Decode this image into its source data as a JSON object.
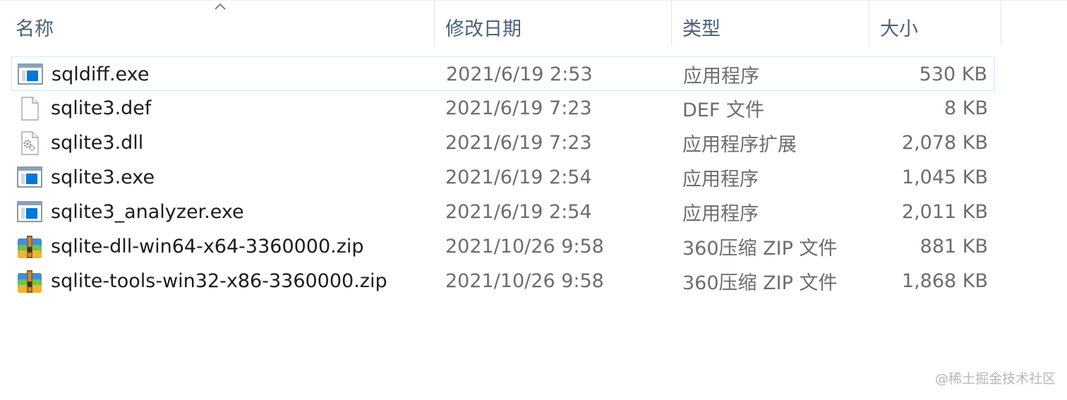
{
  "columns": {
    "name": "名称",
    "date_modified": "修改日期",
    "type": "类型",
    "size": "大小"
  },
  "sort": {
    "column": "name",
    "direction": "ascending",
    "icon": "chevron-up-icon"
  },
  "files": [
    {
      "name": "sqldiff.exe",
      "date": "2021/6/19 2:53",
      "type": "应用程序",
      "size": "530 KB",
      "icon": "exe-app-icon",
      "selected": true
    },
    {
      "name": "sqlite3.def",
      "date": "2021/6/19 7:23",
      "type": "DEF 文件",
      "size": "8 KB",
      "icon": "blank-document-icon",
      "selected": false
    },
    {
      "name": "sqlite3.dll",
      "date": "2021/6/19 7:23",
      "type": "应用程序扩展",
      "size": "2,078 KB",
      "icon": "dll-gear-document-icon",
      "selected": false
    },
    {
      "name": "sqlite3.exe",
      "date": "2021/6/19 2:54",
      "type": "应用程序",
      "size": "1,045 KB",
      "icon": "exe-app-icon",
      "selected": false
    },
    {
      "name": "sqlite3_analyzer.exe",
      "date": "2021/6/19 2:54",
      "type": "应用程序",
      "size": "2,011 KB",
      "icon": "exe-app-icon",
      "selected": false
    },
    {
      "name": "sqlite-dll-win64-x64-3360000.zip",
      "date": "2021/10/26 9:58",
      "type": "360压缩 ZIP 文件",
      "size": "881 KB",
      "icon": "zip-archive-icon",
      "selected": false
    },
    {
      "name": "sqlite-tools-win32-x86-3360000.zip",
      "date": "2021/10/26 9:58",
      "type": "360压缩 ZIP 文件",
      "size": "1,868 KB",
      "icon": "zip-archive-icon",
      "selected": false
    }
  ],
  "colors": {
    "header_text": "#4c607a",
    "name_text": "#1b1b1b",
    "detail_text": "#6d6d6d",
    "selection_border": "#cde8ff",
    "exe_blue": "#0078d7"
  },
  "watermark": "@稀土掘金技术社区"
}
